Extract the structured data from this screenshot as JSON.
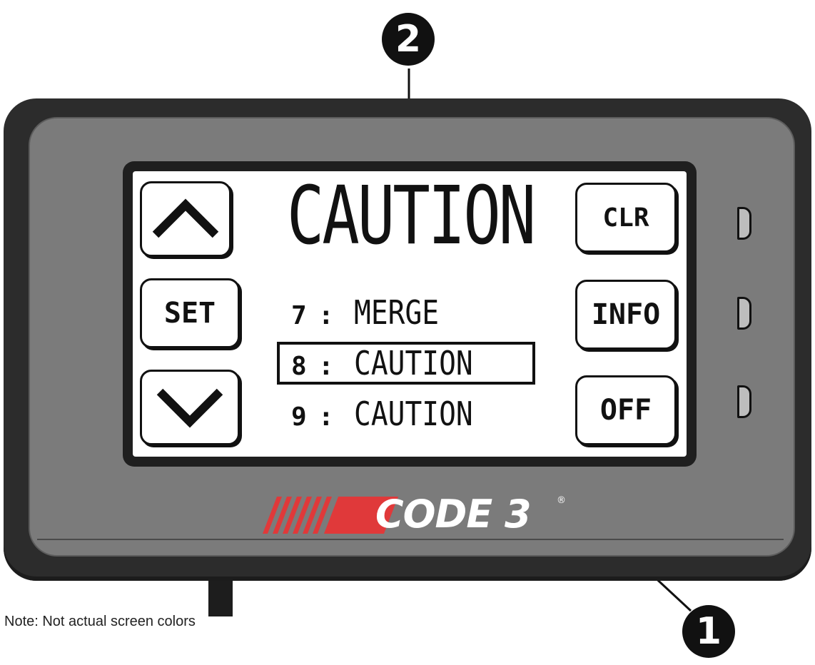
{
  "callouts": {
    "one": "1",
    "two": "2"
  },
  "screen": {
    "title": "CAUTION",
    "buttons": {
      "clear": "CLR",
      "set": "SET",
      "info": "INFO",
      "off": "OFF"
    },
    "list": [
      {
        "number": "7",
        "separator": ":",
        "name": "MERGE",
        "selected": false
      },
      {
        "number": "8",
        "separator": ":",
        "name": "CAUTION",
        "selected": true
      },
      {
        "number": "9",
        "separator": ":",
        "name": "CAUTION",
        "selected": false
      }
    ]
  },
  "brand": {
    "name": "CODE 3",
    "registered": "®",
    "stripe_color": "#e0393a"
  },
  "note": "Note: Not actual screen colors",
  "colors": {
    "device": "#2c2c2c",
    "bezel_face": "#7b7b7b",
    "led": "#bdbdbd"
  },
  "icons": {
    "up": "chevron-up-icon",
    "down": "chevron-down-icon"
  }
}
